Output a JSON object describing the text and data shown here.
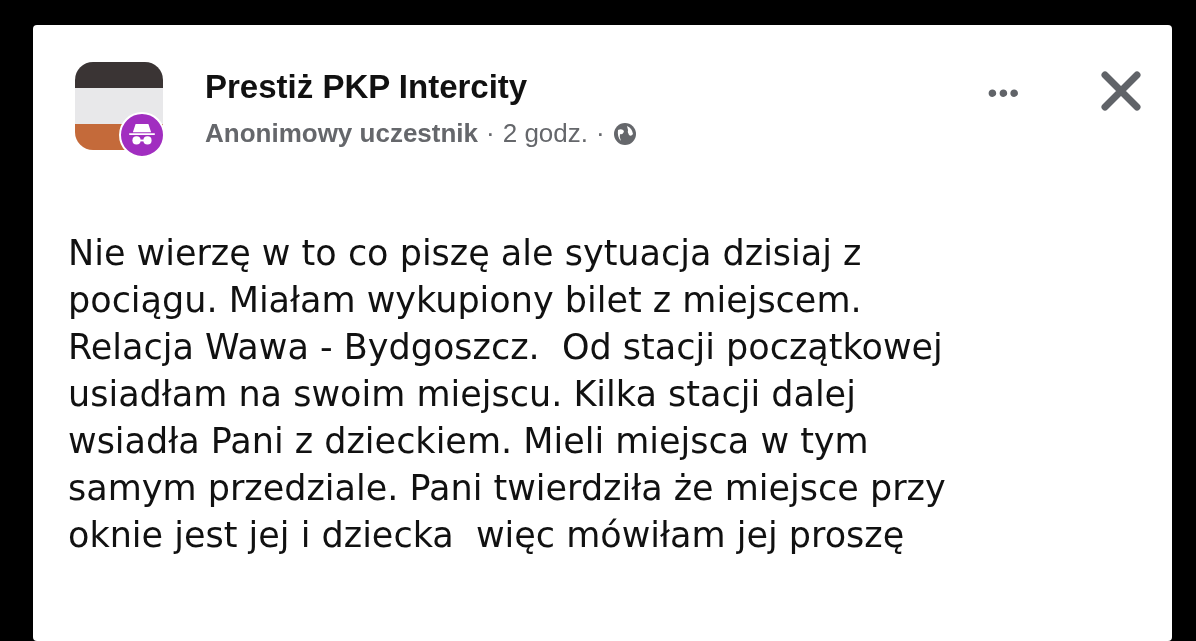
{
  "post": {
    "group_name": "Prestiż PKP Intercity",
    "author": "Anonimowy uczestnik",
    "separator_1": "·",
    "time": "2 godz.",
    "separator_2": "·",
    "more_button": "•••",
    "body": "Nie wierzę w to co piszę ale sytuacja dzisiaj z\npociągu. Miałam wykupiony bilet z miejscem.\nRelacja Wawa - Bydgoszcz.  Od stacji początkowej\nusiadłam na swoim miejscu. Kilka stacji dalej\nwsiadła Pani z dzieckiem. Mieli miejsca w tym\nsamym przedziale. Pani twierdziła że miejsce przy\noknie jest jej i dziecka  więc mówiłam jej proszę"
  }
}
